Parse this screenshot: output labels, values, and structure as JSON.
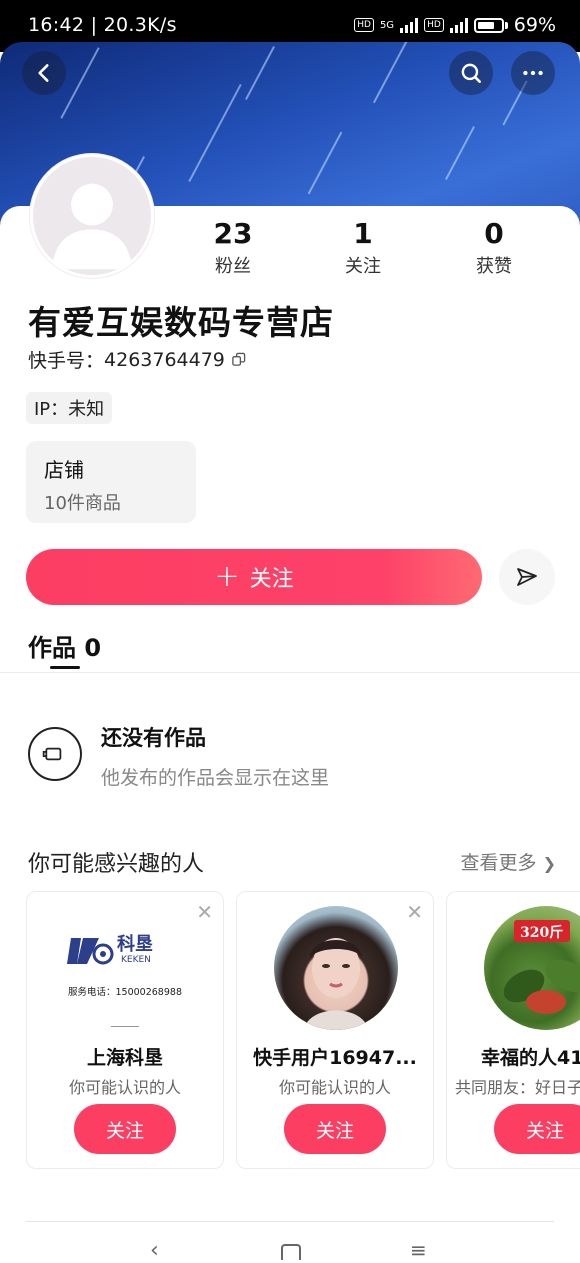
{
  "status_bar": {
    "time": "16:42 | 20.3K/s",
    "battery": "69%",
    "network": "5G"
  },
  "profile": {
    "name": "有爱互娱数码专营店",
    "kuaishou_id_label": "快手号：",
    "kuaishou_id": "4263764479",
    "ip_label": "IP：未知",
    "stats": [
      {
        "value": "23",
        "label": "粉丝"
      },
      {
        "value": "1",
        "label": "关注"
      },
      {
        "value": "0",
        "label": "获赞"
      }
    ]
  },
  "store": {
    "title": "店铺",
    "subtitle": "10件商品"
  },
  "actions": {
    "follow_label": "关注",
    "follow_icon": "+"
  },
  "tabs": [
    {
      "label": "作品 0"
    }
  ],
  "empty_state": {
    "title": "还没有作品",
    "subtitle": "他发布的作品会显示在这里"
  },
  "recommendations": {
    "title": "你可能感兴趣的人",
    "more_label": "查看更多",
    "items": [
      {
        "name": "上海科垦",
        "reason": "你可能认识的人",
        "button": "关注",
        "logo_text": "科垦",
        "logo_sub": "KEKEN",
        "logo_phone": "服务电话：15000268988"
      },
      {
        "name": "快手用户16947...",
        "reason": "你可能认识的人",
        "button": "关注"
      },
      {
        "name": "幸福的人41",
        "reason": "共同朋友：好日子",
        "button": "关注",
        "photo_tag": "320斤"
      }
    ]
  },
  "colors": {
    "accent": "#fd3e63",
    "banner": "#2351b8"
  }
}
